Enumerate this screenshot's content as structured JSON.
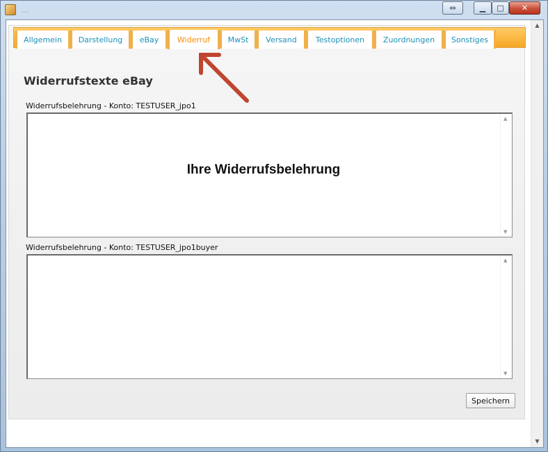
{
  "window": {
    "title": "...",
    "resize_icon": "⇔",
    "minimize_icon": "▁",
    "maximize_icon": "□",
    "close_icon": "✕"
  },
  "tabs": [
    {
      "label": "Allgemein",
      "active": false
    },
    {
      "label": "Darstellung",
      "active": false
    },
    {
      "label": "eBay",
      "active": false
    },
    {
      "label": "Widerruf",
      "active": true
    },
    {
      "label": "MwSt",
      "active": false
    },
    {
      "label": "Versand",
      "active": false
    },
    {
      "label": "Testoptionen",
      "active": false
    },
    {
      "label": "Zuordnungen",
      "active": false
    },
    {
      "label": "Sonstiges",
      "active": false
    }
  ],
  "heading": "Widerrufstexte eBay",
  "fields": [
    {
      "label": "Widerrufsbelehrung - Konto: TESTUSER_jpo1",
      "value": "Ihre Widerrufsbelehrung"
    },
    {
      "label": "Widerrufsbelehrung - Konto: TESTUSER_jpo1buyer",
      "value": ""
    }
  ],
  "save_label": "Speichern",
  "colors": {
    "tab_text": "#1a8fb8",
    "active_tab_text": "#ff8a00",
    "tab_bar": "#f5a623",
    "annotation_arrow": "#c0452f"
  },
  "icons": {
    "scroll_up": "▲",
    "scroll_down": "▼"
  }
}
